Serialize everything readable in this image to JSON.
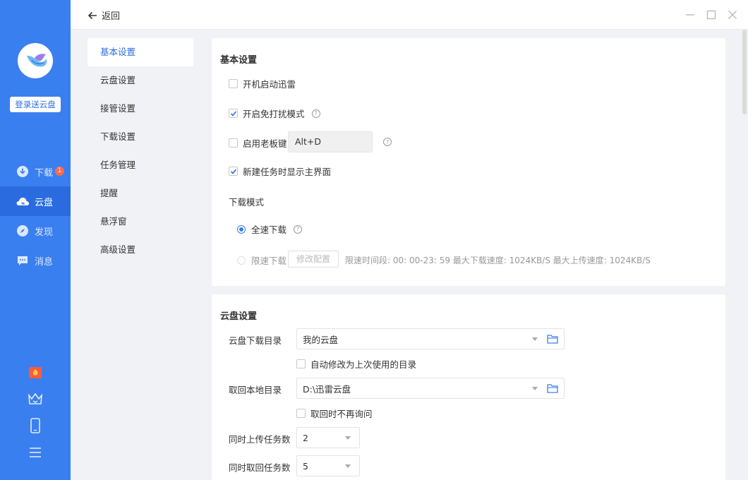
{
  "sidebar": {
    "login_label": "登录送云盘",
    "nav": [
      {
        "label": "下载",
        "icon": "download-icon",
        "badge": "1",
        "active": false
      },
      {
        "label": "云盘",
        "icon": "cloud-icon",
        "active": true
      },
      {
        "label": "发现",
        "icon": "compass-icon",
        "active": false
      },
      {
        "label": "消息",
        "icon": "message-icon",
        "active": false
      }
    ],
    "bottom_icons": [
      "gift-icon",
      "crown-icon",
      "phone-icon",
      "menu-icon"
    ]
  },
  "titlebar": {
    "back_label": "返回"
  },
  "menu": {
    "items": [
      "基本设置",
      "云盘设置",
      "接管设置",
      "下载设置",
      "任务管理",
      "提醒",
      "悬浮窗",
      "高级设置"
    ],
    "active_index": 0
  },
  "basic": {
    "title": "基本设置",
    "autostart": {
      "label": "开机启动迅雷",
      "checked": false
    },
    "nodisturb": {
      "label": "开启免打扰模式",
      "checked": true
    },
    "bosskey": {
      "label": "启用老板键",
      "checked": false,
      "value": "Alt+D"
    },
    "showmain": {
      "label": "新建任务时显示主界面",
      "checked": true
    },
    "download_mode_label": "下载模式",
    "full_speed": {
      "label": "全速下载",
      "selected": true
    },
    "limit_speed": {
      "label": "限速下载",
      "selected": false,
      "config_button": "修改配置",
      "info": "限速时间段:  00: 00-23: 59   最大下载速度: 1024KB/S   最大上传速度: 1024KB/S"
    }
  },
  "cloud": {
    "title": "云盘设置",
    "download_dir": {
      "label": "云盘下载目录",
      "value": "我的云盘"
    },
    "auto_modify": {
      "label": "自动修改为上次使用的目录",
      "checked": false
    },
    "local_dir": {
      "label": "取回本地目录",
      "value": "D:\\迅雷云盘"
    },
    "no_ask": {
      "label": "取回时不再询问",
      "checked": false
    },
    "upload_count": {
      "label": "同时上传任务数",
      "value": "2"
    },
    "fetch_count": {
      "label": "同时取回任务数",
      "value": "5"
    }
  },
  "colors": {
    "accent": "#3a7ff0",
    "sidebar_active": "#2a6ce0",
    "badge": "#ff6a4d"
  }
}
